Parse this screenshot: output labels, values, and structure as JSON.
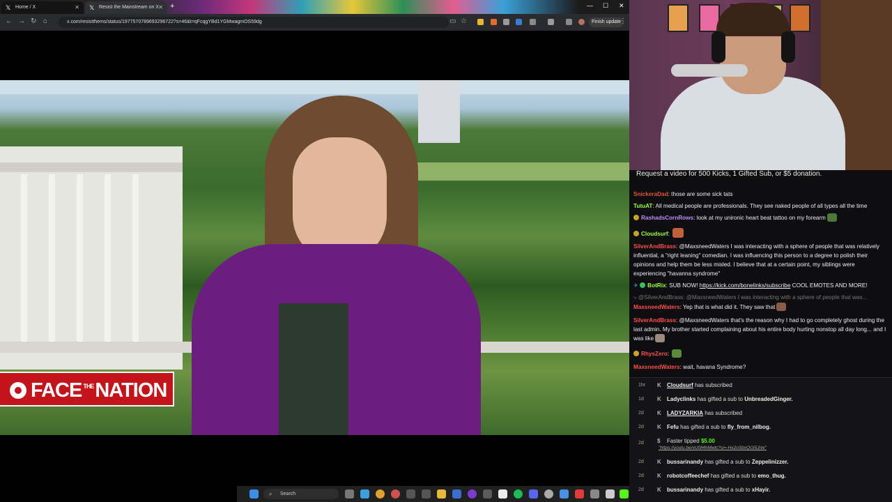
{
  "browser": {
    "tabs": [
      {
        "title": "Home / X"
      },
      {
        "title": "Resist the Mainstream on X"
      }
    ],
    "url": "x.com/resistthems/status/1977570789693296722?s=46&t=qFcqgYBd1YGMwagmOS59dg",
    "finish_update": "Finish update"
  },
  "video": {
    "logo": "FACE THE NATION",
    "logo_parts": {
      "main": "FACE",
      "small": "THE",
      "end": "NATION"
    }
  },
  "chat": {
    "pinned": "Request a video for 500 Kicks, 1 Gifted Sub, or $5 donation.",
    "messages": [
      {
        "user": "SnickeraDad",
        "color": "#e0543a",
        "text": "those are some sick tats"
      },
      {
        "user": "TutuAT",
        "color": "#9cff4a",
        "text": "All medical people are professionals. They see naked people of all types all the time"
      },
      {
        "user": "RashadsCornRows",
        "color": "#c28bff",
        "text": "look at my unironic heart beat tattoo on my forearm"
      },
      {
        "user": "Cloudsurf",
        "color": "#9cff4a",
        "text": ""
      },
      {
        "user": "SilverAndBrass",
        "color": "#ff4f4f",
        "text": "@MaxsneedWaters I was interacting with a sphere of people that was relatively influential, a \"right leaning\" comedian. I was influencing this person to a degree to polish their opinions and help them be less misled. I believe that at a certain point, my siblings were experiencing \"havanna syndrome\""
      },
      {
        "user": "BotRix",
        "color": "#9cff4a",
        "text": "SUB NOW!",
        "link": "https://kick.com/bonelinks/subscribe",
        "after": "COOL EMOTES AND MORE!"
      },
      {
        "reply": "@SilverAndBrass: @MaxsneedWaters I was interacting with a sphere of people that was..."
      },
      {
        "user": "MaxsneedWaters",
        "color": "#ff4f4f",
        "text": "Yep that is what did it. They saw that"
      },
      {
        "user": "SilverAndBrass",
        "color": "#ff4f4f",
        "text": "@MaxsneedWaters that's the reason why I had to go completely ghost during the last admin. My brother started complaining about his entire body hurting nonstop all day long... and I was like"
      },
      {
        "user": "RhysZero",
        "color": "#ff4f4f",
        "text": ""
      },
      {
        "user": "MaxsneedWaters",
        "color": "#ff4f4f",
        "text": "wait, havana Syndrome?"
      }
    ]
  },
  "events": [
    {
      "time": "1hr",
      "user": "Cloudsurf",
      "action": "has subscribed",
      "target": ""
    },
    {
      "time": "1d",
      "user": "Ladyclinks",
      "action": "has gifted a sub to",
      "target": "UnbreadedGinger."
    },
    {
      "time": "2d",
      "user": "LADYZARKIA",
      "action": "has subscribed",
      "target": ""
    },
    {
      "time": "2d",
      "user": "Fefu",
      "action": "has gifted a sub to",
      "target": "fly_from_nilbog."
    },
    {
      "time": "2d",
      "user": "Faster",
      "action": "tipped",
      "target": "$5.00",
      "note": "\"https://youtu.be/vU0ll4hMwtc?si=-Hx2oSbxQOi5Jnlv\""
    },
    {
      "time": "2d",
      "user": "bussarinandy",
      "action": "has gifted a sub to",
      "target": "Zeppelinizzer."
    },
    {
      "time": "2d",
      "user": "robotcoffeechef",
      "action": "has gifted a sub to",
      "target": "emo_thug."
    },
    {
      "time": "2d",
      "user": "bussarinandy",
      "action": "has gifted a sub to",
      "target": "xHayir."
    }
  ],
  "taskbar": {
    "search": "Search"
  },
  "colors": {
    "accent": "#53fc18",
    "cbs_red": "#c3141c",
    "chat_bg": "#0e0e10"
  }
}
